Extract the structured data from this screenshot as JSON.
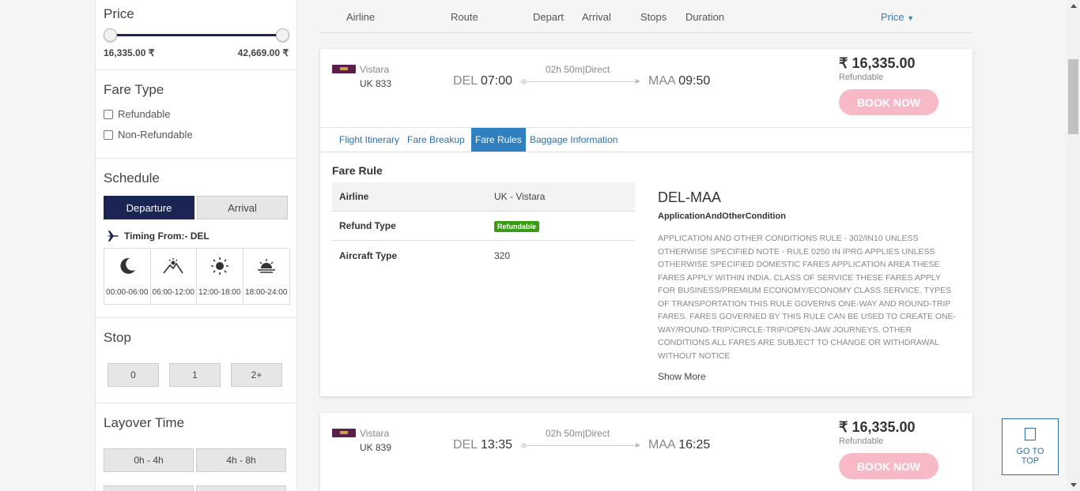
{
  "filters": {
    "price": {
      "title": "Price",
      "min": "16,335.00 ₹",
      "max": "42,669.00 ₹"
    },
    "fare_type": {
      "title": "Fare Type",
      "options": [
        "Refundable",
        "Non-Refundable"
      ]
    },
    "schedule": {
      "title": "Schedule",
      "departure_label": "Departure",
      "arrival_label": "Arrival",
      "timing_from": "Timing From:- DEL",
      "slots": [
        "00:00-06:00",
        "06:00-12:00",
        "12:00-18:00",
        "18:00-24:00"
      ]
    },
    "stop": {
      "title": "Stop",
      "options": [
        "0",
        "1",
        "2+"
      ]
    },
    "layover": {
      "title": "Layover Time",
      "options": [
        "0h - 4h",
        "4h - 8h"
      ]
    }
  },
  "header": {
    "airline": "Airline",
    "route": "Route",
    "depart": "Depart",
    "arrival": "Arrival",
    "stops": "Stops",
    "duration": "Duration",
    "price": "Price"
  },
  "flights": [
    {
      "airline": "Vistara",
      "flight_no": "UK  833",
      "from": "DEL",
      "dep_time": "07:00",
      "to": "MAA",
      "arr_time": "09:50",
      "duration": "02h 50m|Direct",
      "fare": "₹ 16,335.00",
      "refund": "Refundable",
      "book": "BOOK NOW"
    },
    {
      "airline": "Vistara",
      "flight_no": "UK  839",
      "from": "DEL",
      "dep_time": "13:35",
      "to": "MAA",
      "arr_time": "16:25",
      "duration": "02h 50m|Direct",
      "fare": "₹ 16,335.00",
      "refund": "Refundable",
      "book": "BOOK NOW"
    }
  ],
  "tabs": [
    "Flight Itinerary",
    "Fare Breakup",
    "Fare Rules",
    "Baggage Information"
  ],
  "fare_rule": {
    "title": "Fare Rule",
    "rows": [
      {
        "k": "Airline",
        "v": "UK - Vistara"
      },
      {
        "k": "Refund Type",
        "v": "Refundable"
      },
      {
        "k": "Aircraft Type",
        "v": "320"
      }
    ],
    "route": "DEL-MAA",
    "subtitle": "ApplicationAndOtherCondition",
    "text": "APPLICATION AND OTHER CONDITIONS RULE - 302/IN10 UNLESS OTHERWISE SPECIFIED NOTE - RULE 0250 IN IPRG APPLIES UNLESS OTHERWISE SPECIFIED DOMESTIC FARES APPLICATION AREA THESE FARES APPLY WITHIN INDIA. CLASS OF SERVICE THESE FARES APPLY FOR BUSINESS/PREMIUM ECONOMY/ECONOMY CLASS SERVICE. TYPES OF TRANSPORTATION THIS RULE GOVERNS ONE-WAY AND ROUND-TRIP FARES. FARES GOVERNED BY THIS RULE CAN BE USED TO CREATE ONE-WAY/ROUND-TRIP/CIRCLE-TRIP/OPEN-JAW JOURNEYS. OTHER CONDITIONS ALL FARES ARE SUBJECT TO CHANGE OR WITHDRAWAL WITHOUT NOTICE",
    "show_more": "Show More"
  },
  "go_to_top": {
    "line1": "GO TO",
    "line2": "TOP"
  },
  "colors": {
    "navy": "#1a2553",
    "link": "#2f7fc1",
    "book": "#f8b9c7",
    "refund_badge": "#3a9b16"
  }
}
